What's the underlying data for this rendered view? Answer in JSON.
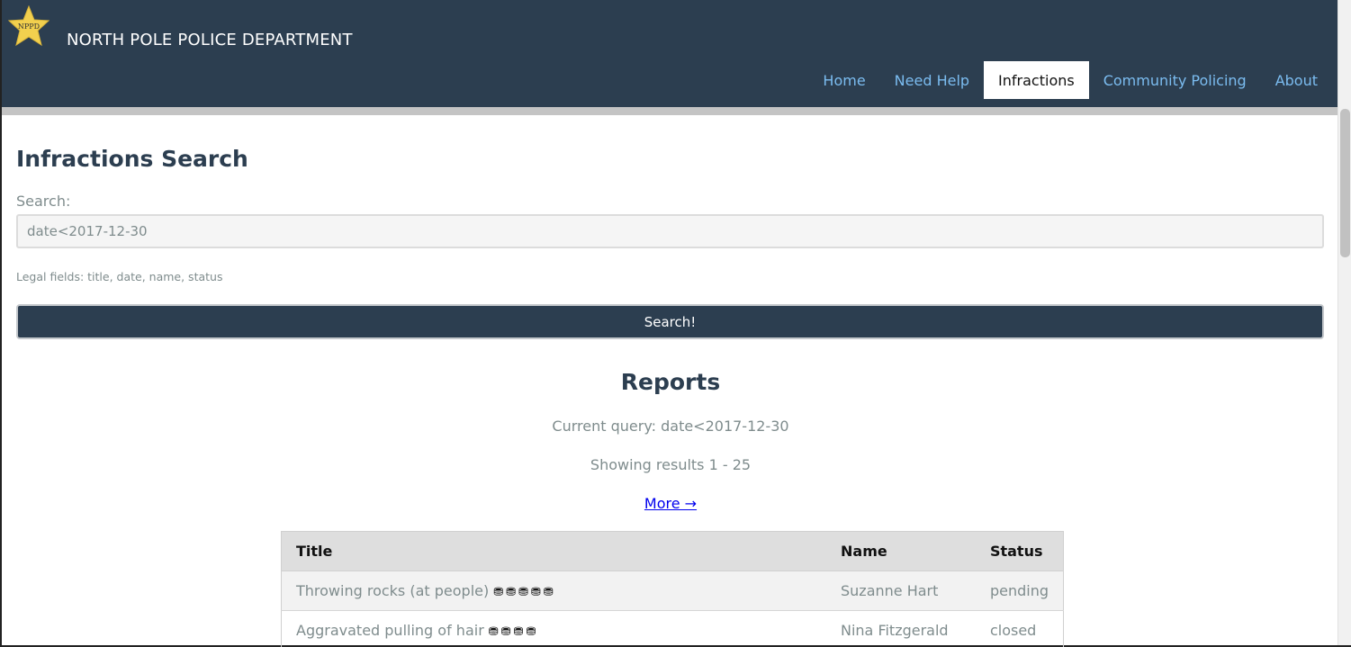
{
  "header": {
    "logo_text": "NPPD",
    "site_title": "NORTH POLE POLICE DEPARTMENT",
    "nav": [
      {
        "label": "Home"
      },
      {
        "label": "Need Help"
      },
      {
        "label": "Infractions",
        "active": true
      },
      {
        "label": "Community Policing"
      },
      {
        "label": "About"
      }
    ]
  },
  "search": {
    "page_title": "Infractions Search",
    "label": "Search:",
    "value": "date<2017-12-30",
    "help_text": "Legal fields: title, date, name, status",
    "button_label": "Search!"
  },
  "reports": {
    "heading": "Reports",
    "current_query": "Current query: date<2017-12-30",
    "showing": "Showing results 1 - 25",
    "more_link": "More →",
    "columns": {
      "title": "Title",
      "name": "Name",
      "status": "Status"
    },
    "rows": [
      {
        "title": "Throwing rocks (at people)",
        "coals": "⛃⛃⛃⛃⛃",
        "name": "Suzanne Hart",
        "status": "pending"
      },
      {
        "title": "Aggravated pulling of hair",
        "coals": "⛃⛃⛃⛃",
        "name": "Nina Fitzgerald",
        "status": "closed"
      }
    ]
  },
  "colors": {
    "header_bg": "#2c3e50",
    "nav_link": "#7bbcf0",
    "muted_text": "#7f8c8d",
    "logo_star": "#f2d04e"
  },
  "icons": {
    "logo": "star-badge-icon",
    "coal": "lump-of-coal-icon"
  }
}
